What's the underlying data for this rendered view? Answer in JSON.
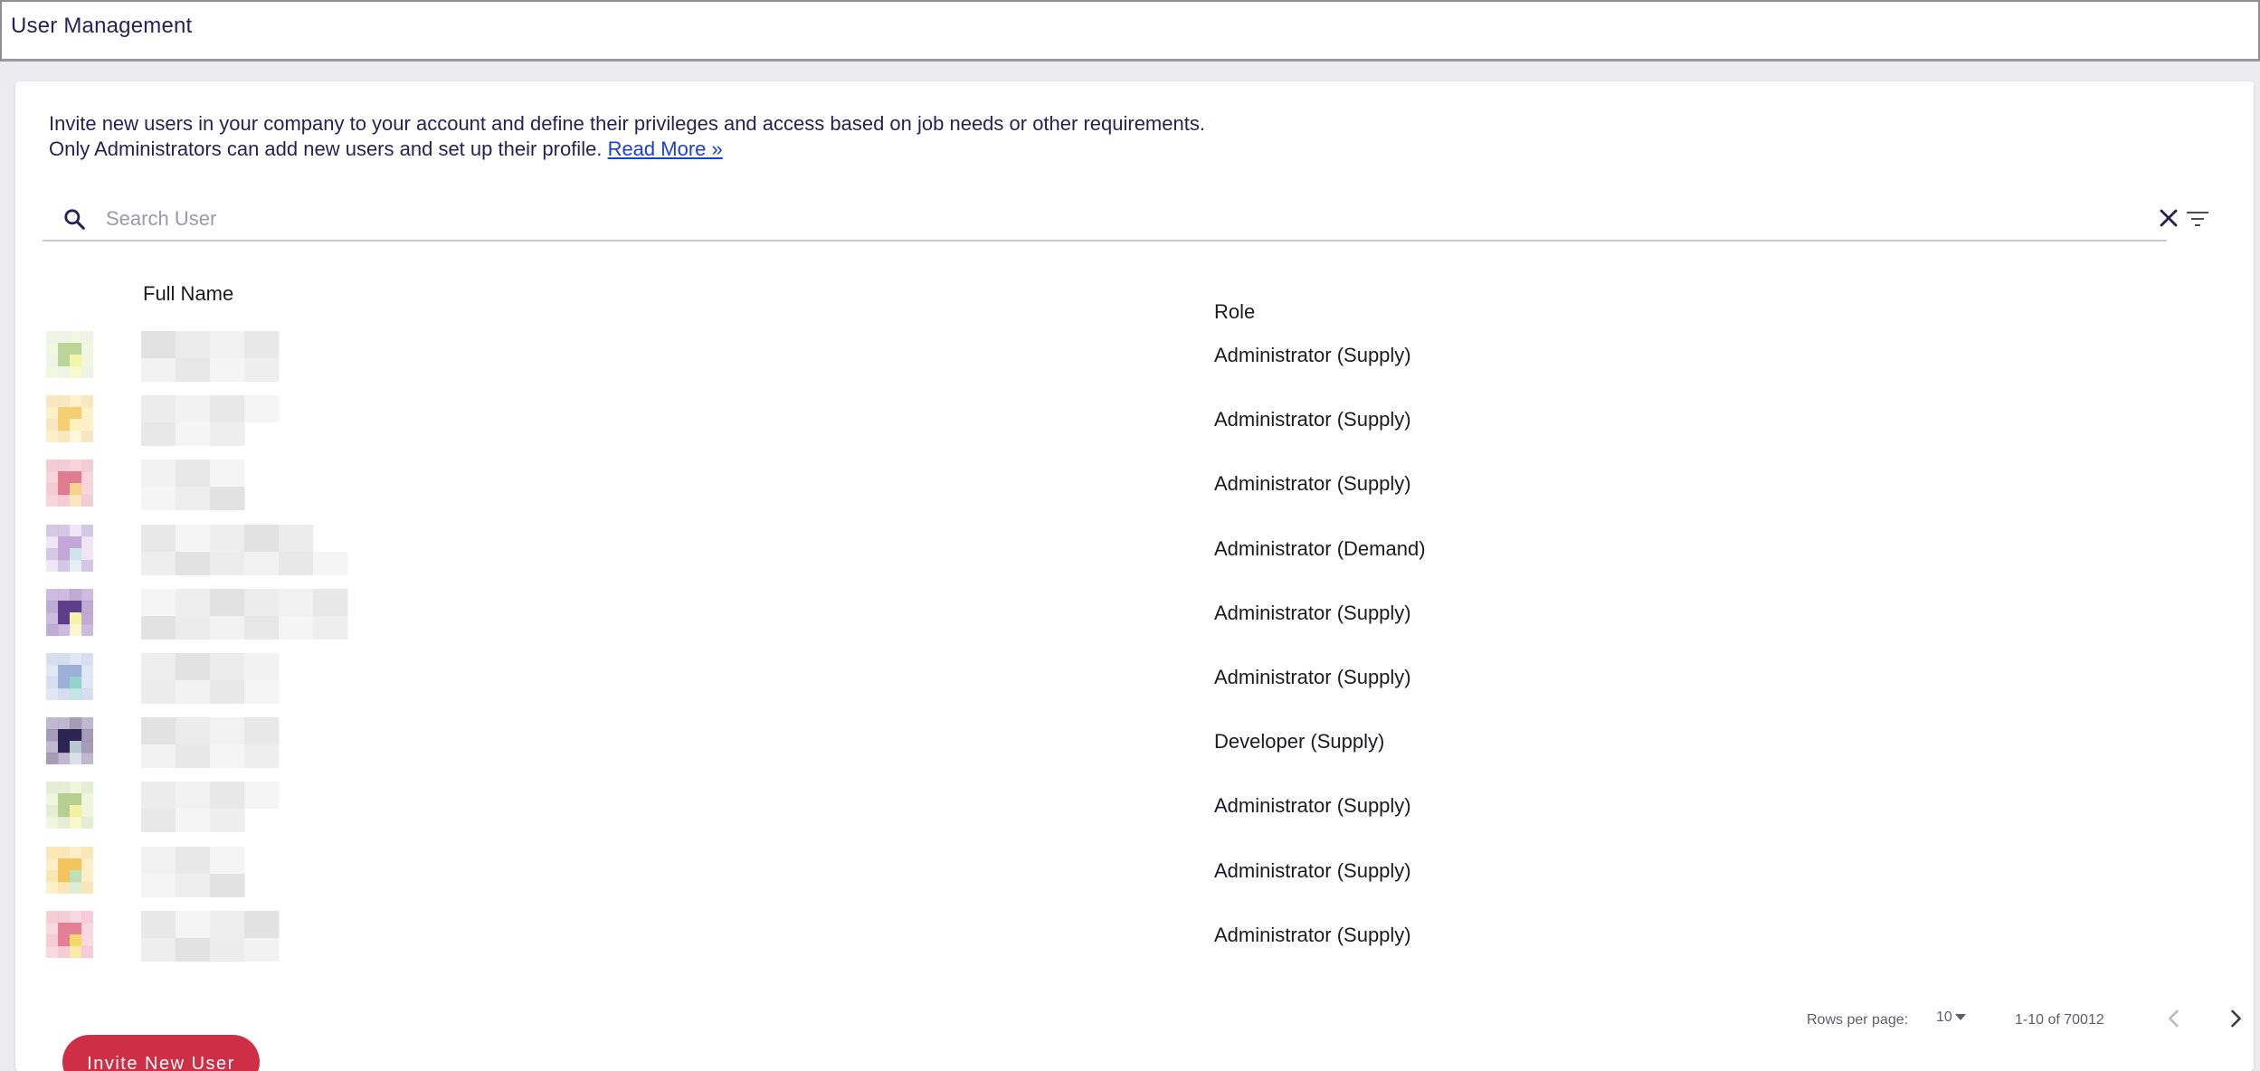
{
  "app": {
    "title": "User Management"
  },
  "intro": {
    "line1": "Invite new users in your company to your account and define their privileges and access based on job needs or other requirements.",
    "line2": "Only Administrators can add new users and set up their profile.",
    "read_more": "Read More »"
  },
  "search": {
    "placeholder": "Search User",
    "value": ""
  },
  "table": {
    "headers": {
      "name": "Full Name",
      "role": "Role"
    },
    "rows": [
      {
        "role": "Administrator (Supply)",
        "avatar_palette": [
          "#bcd39a",
          "#e7f0c4",
          "#f3f6a8",
          "#e0ecd2"
        ]
      },
      {
        "role": "Administrator (Supply)",
        "avatar_palette": [
          "#f6cf73",
          "#fbe59f",
          "#fff1bf",
          "#f3d690"
        ]
      },
      {
        "role": "Administrator (Supply)",
        "avatar_palette": [
          "#e07c92",
          "#f2b3c1",
          "#f7d38a",
          "#eaa3b4"
        ]
      },
      {
        "role": "Administrator (Demand)",
        "avatar_palette": [
          "#c4a7d8",
          "#e3d3ee",
          "#cfe3ea",
          "#b29ad0"
        ]
      },
      {
        "role": "Administrator (Supply)",
        "avatar_palette": [
          "#5e3d8a",
          "#8c66b0",
          "#f7f2a8",
          "#a684c6"
        ]
      },
      {
        "role": "Administrator (Supply)",
        "avatar_palette": [
          "#9cb0d8",
          "#c8d4ec",
          "#93d3cf",
          "#b4c2e2"
        ]
      },
      {
        "role": "Developer (Supply)",
        "avatar_palette": [
          "#2c2452",
          "#5b4a7e",
          "#b8c8d0",
          "#8a7ea6"
        ]
      },
      {
        "role": "Administrator (Supply)",
        "avatar_palette": [
          "#b6cf90",
          "#e2eec0",
          "#f4f2a0",
          "#cfe0b2"
        ]
      },
      {
        "role": "Administrator (Supply)",
        "avatar_palette": [
          "#f2c55e",
          "#fbe39a",
          "#bde0b8",
          "#f6d27a"
        ]
      },
      {
        "role": "Administrator (Supply)",
        "avatar_palette": [
          "#e38096",
          "#f3bac8",
          "#f5da6a",
          "#eba4b4"
        ]
      }
    ]
  },
  "pagination": {
    "rows_per_page_label": "Rows per page:",
    "rows_per_page_value": "10",
    "range": "1-10 of 70012"
  },
  "actions": {
    "invite": "Invite New User"
  },
  "colors": {
    "accent": "#cf2f46",
    "title": "#2a1f55",
    "link": "#1a3fd6",
    "name_placeholder": "#e6e6e6"
  }
}
